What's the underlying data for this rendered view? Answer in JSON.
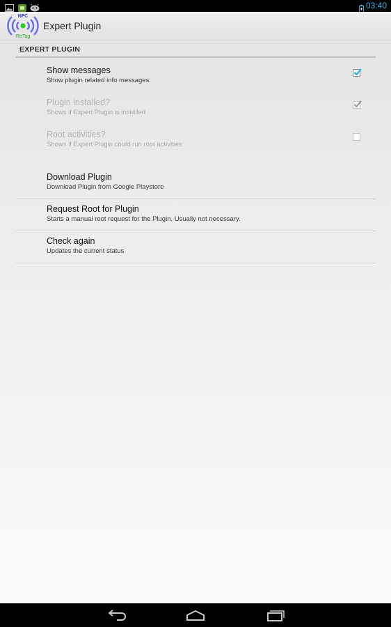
{
  "status_bar": {
    "time": "03:40",
    "icons": [
      "image-icon",
      "app-notification-icon",
      "android-robot-icon"
    ],
    "battery_icon": "battery-charging-icon",
    "accent_color": "#33b5e5"
  },
  "action_bar": {
    "title": "Expert Plugin",
    "logo": {
      "top_text": "NFC",
      "bottom_text": "ReTag",
      "icon": "nfc-retag-logo-icon"
    }
  },
  "category": {
    "header": "EXPERT PLUGIN"
  },
  "preferences": [
    {
      "title": "Show messages",
      "summary": "Show plugin related info messages.",
      "checked": true,
      "enabled": true
    },
    {
      "title": "Plugin installed?",
      "summary": "Shows if Expert Plugin is installed",
      "checked": true,
      "enabled": false
    },
    {
      "title": "Root activities?",
      "summary": "Shows if Expert Plugin could run root activities",
      "checked": false,
      "enabled": false
    },
    {
      "title": "Download Plugin",
      "summary": "Download Plugin from Google Playstore"
    },
    {
      "title": "Request Root for Plugin",
      "summary": "Starts a manual root request for the Plugin. Usually not necessary."
    },
    {
      "title": "Check again",
      "summary": "Updates the current status"
    }
  ],
  "nav_bar": {
    "icons": [
      "back-icon",
      "home-icon",
      "recent-apps-icon"
    ]
  },
  "colors": {
    "check_blue": "#33b5e5",
    "check_disabled": "#9a9a9a"
  }
}
